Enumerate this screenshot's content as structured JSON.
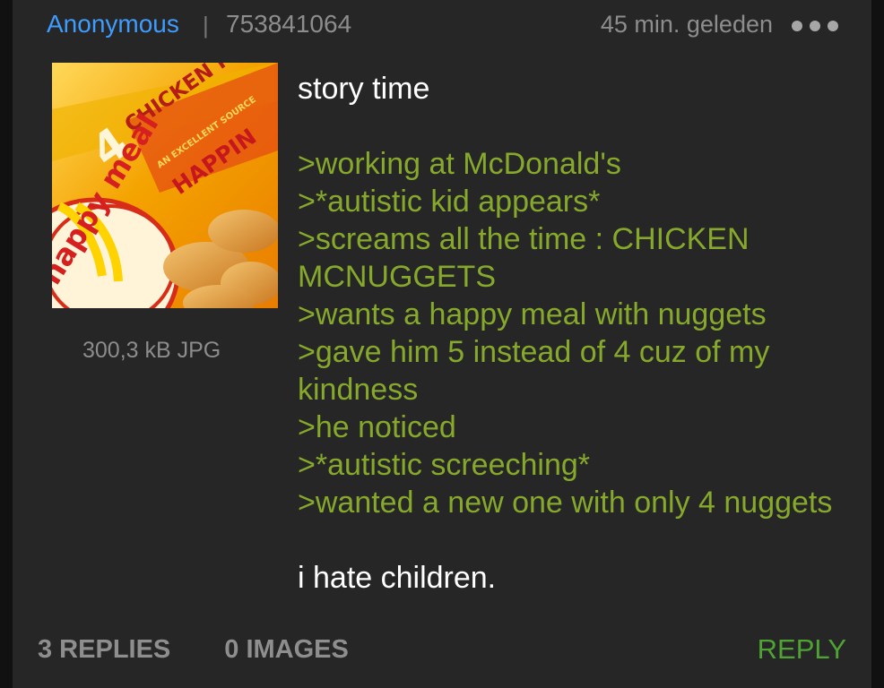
{
  "post": {
    "author": "Anonymous",
    "separator": "|",
    "post_id": "753841064",
    "time_ago": "45 min. geleden",
    "file_meta": "300,3 kB JPG",
    "lines": [
      {
        "text": "story time",
        "type": "plain"
      },
      {
        "text": "",
        "type": "gap"
      },
      {
        "text": ">working at McDonald's",
        "type": "quote"
      },
      {
        "text": ">*autistic kid appears*",
        "type": "quote"
      },
      {
        "text": ">screams all the time : CHICKEN",
        "type": "quote"
      },
      {
        "text": "MCNUGGETS",
        "type": "quote"
      },
      {
        "text": ">wants a happy meal with nuggets",
        "type": "quote"
      },
      {
        "text": ">gave him 5 instead of 4 cuz of my",
        "type": "quote"
      },
      {
        "text": "kindness",
        "type": "quote"
      },
      {
        "text": ">he noticed",
        "type": "quote"
      },
      {
        "text": ">*autistic screeching*",
        "type": "quote"
      },
      {
        "text": ">wanted a new one with only 4 nuggets",
        "type": "quote"
      },
      {
        "text": "",
        "type": "gap"
      },
      {
        "text": "i hate children.",
        "type": "plain"
      }
    ]
  },
  "thumbnail": {
    "brand_text": "happy meal",
    "product_text": "CHICKEN McNUGGETS",
    "count_text": "4",
    "tagline_text": "AN EXCELLENT SOURCE",
    "banner_text": "HAPPIN"
  },
  "footer": {
    "replies": "3 REPLIES",
    "images": "0 IMAGES",
    "reply_label": "REPLY"
  },
  "colors": {
    "background": "#262626",
    "author": "#3f9cff",
    "meta": "#8d8d8d",
    "quote": "#86a92c",
    "reply": "#4ea334"
  },
  "icons": {
    "more": "more-horizontal-icon"
  }
}
